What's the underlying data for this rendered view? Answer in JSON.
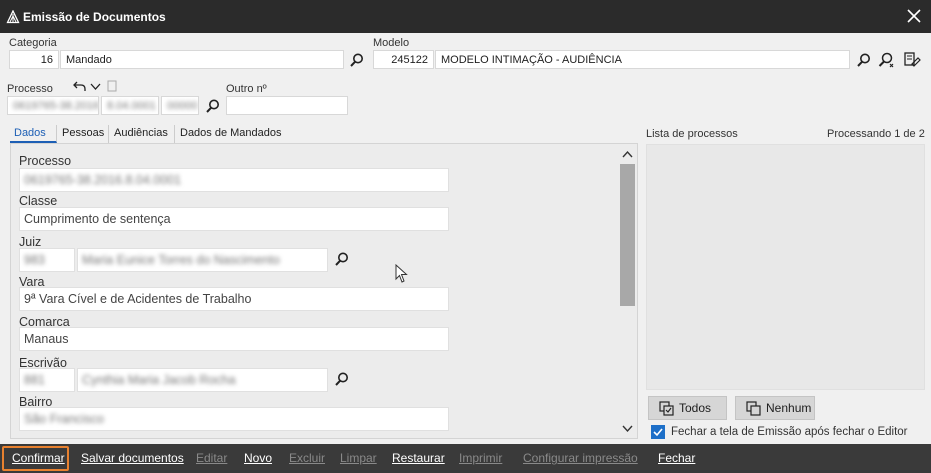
{
  "window": {
    "title": "Emissão de Documentos"
  },
  "categoria": {
    "label": "Categoria",
    "code": "16",
    "name": "Mandado"
  },
  "modelo": {
    "label": "Modelo",
    "code": "245122",
    "name": "MODELO INTIMAÇÃO - AUDIÊNCIA"
  },
  "processo_top": {
    "label": "Processo",
    "part1": "0619765-38.2016",
    "part2": "8.04.0001",
    "part3": "00000"
  },
  "outro": {
    "label": "Outro nº",
    "value": ""
  },
  "tabs": [
    {
      "label": "Dados"
    },
    {
      "label": "Pessoas"
    },
    {
      "label": "Audiências"
    },
    {
      "label": "Dados de Mandados"
    }
  ],
  "form": {
    "processo": {
      "label": "Processo",
      "value": "0619765-38.2016.8.04.0001"
    },
    "classe": {
      "label": "Classe",
      "value": "Cumprimento de sentença"
    },
    "juiz": {
      "label": "Juiz",
      "code": "983",
      "name": "Maria Eunice Torres do Nascimento"
    },
    "vara": {
      "label": "Vara",
      "value": "9ª Vara Cível e de Acidentes de Trabalho"
    },
    "comarca": {
      "label": "Comarca",
      "value": "Manaus"
    },
    "escrivao": {
      "label": "Escrivão",
      "code": "881",
      "name": "Cynthia Maria Jacob Rocha"
    },
    "bairro": {
      "label": "Bairro",
      "value": "São Francisco"
    }
  },
  "lista": {
    "label": "Lista de processos",
    "status": "Processando 1 de 2"
  },
  "buttons": {
    "todos": "Todos",
    "nenhum": "Nenhum"
  },
  "checkbox": {
    "label": "Fechar a tela de Emissão após fechar o Editor",
    "checked": true
  },
  "actions": [
    {
      "label": "Confirmar",
      "enabled": true
    },
    {
      "label": "Salvar documentos",
      "enabled": true
    },
    {
      "label": "Editar",
      "enabled": false
    },
    {
      "label": "Novo",
      "enabled": true
    },
    {
      "label": "Excluir",
      "enabled": false
    },
    {
      "label": "Limpar",
      "enabled": false
    },
    {
      "label": "Restaurar",
      "enabled": true
    },
    {
      "label": "Imprimir",
      "enabled": false
    },
    {
      "label": "Configurar impressão",
      "enabled": false
    },
    {
      "label": "Fechar",
      "enabled": true
    }
  ],
  "colors": {
    "titlebar": "#2b2b2b",
    "accent": "#1d5fb5",
    "focus": "#e8812f",
    "bottombar": "#3a3a3a"
  },
  "icons": [
    "app-logo-icon",
    "close-icon",
    "search-icon",
    "search-model-icon",
    "edit-model-icon",
    "undo-icon",
    "chevron-down-icon",
    "copy-icon",
    "select-all-icon",
    "select-none-icon",
    "checkmark-icon",
    "scroll-up-icon",
    "scroll-down-icon",
    "mouse-cursor-icon"
  ]
}
